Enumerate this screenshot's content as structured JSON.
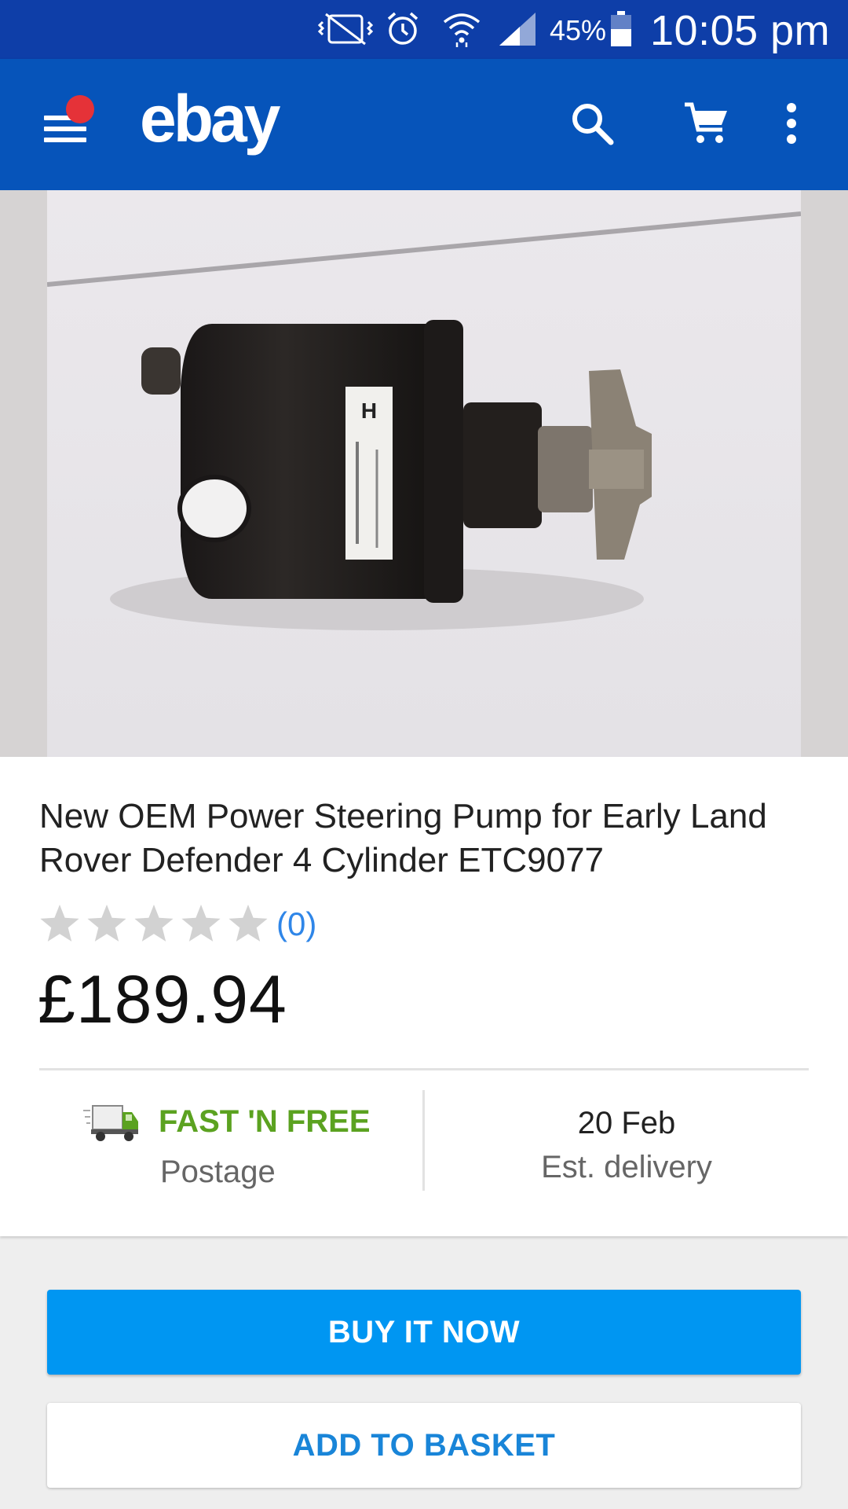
{
  "status_bar": {
    "battery_percent": "45%",
    "time": "10:05 pm",
    "icons": [
      "mute-vibrate-icon",
      "alarm-icon",
      "wifi-icon",
      "signal-icon",
      "battery-icon"
    ]
  },
  "app_bar": {
    "logo_text": "ebay",
    "icons": [
      "menu-icon",
      "search-icon",
      "cart-icon",
      "more-vert-icon"
    ],
    "notification_dot_color": "#e53238",
    "background": "#0654ba"
  },
  "listing": {
    "title": "New OEM Power Steering Pump for Early Land Rover Defender 4 Cylinder ETC9077",
    "rating": {
      "stars_filled": 0,
      "stars_total": 5,
      "count_text": "(0)"
    },
    "price": "£189.94",
    "shipping": {
      "title": "FAST 'N FREE",
      "subtitle": "Postage",
      "icon": "truck-icon"
    },
    "delivery": {
      "date": "20 Feb",
      "label": "Est. delivery"
    }
  },
  "actions": {
    "buy_now": "BUY IT NOW",
    "add_to_basket": "ADD TO BASKET"
  },
  "colors": {
    "status_bar": "#0e3ea8",
    "buy_button": "#0096f2",
    "fast_n_free": "#5ba220",
    "link_blue": "#2f86e8"
  }
}
